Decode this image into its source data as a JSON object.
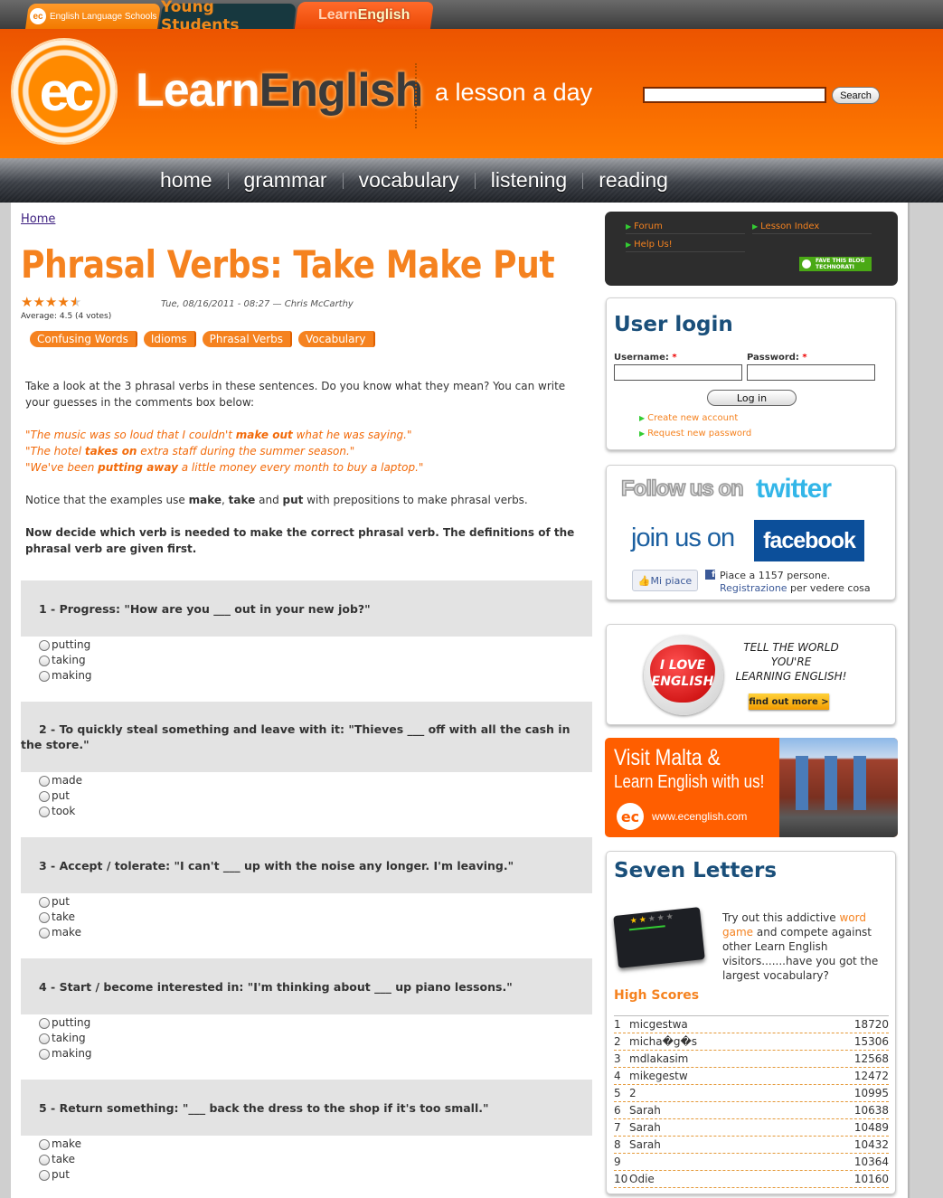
{
  "site_tabs": {
    "ec_schools": "English Language Schools",
    "ec_badge": "ec",
    "young_students": "Young Students",
    "learn_english_part1": "Learn",
    "learn_english_part2": "English"
  },
  "header": {
    "logo_text": "ec",
    "brand_part1": "Learn",
    "brand_part2": "English",
    "tagline": "a lesson a day",
    "search_value": "",
    "search_button": "Search"
  },
  "nav": {
    "items": [
      "home",
      "grammar",
      "vocabulary",
      "listening",
      "reading"
    ]
  },
  "breadcrumb": "Home",
  "article": {
    "title": "Phrasal Verbs: Take Make Put",
    "rating": {
      "stars": 4.5,
      "max": 5,
      "text": "Average: 4.5 (4 votes)"
    },
    "meta": "Tue, 08/16/2011 - 08:27 — Chris McCarthy",
    "tags": [
      "Confusing Words",
      "Idioms",
      "Phrasal Verbs",
      "Vocabulary"
    ],
    "intro": "Take a look at the 3 phrasal verbs in these sentences. Do you know what they mean? You can write your guesses in the comments box below:",
    "examples": [
      {
        "before": "\"The music was so loud that I couldn't ",
        "bold": "make out",
        "after": " what he was saying.\""
      },
      {
        "before": "\"The hotel ",
        "bold": "takes on",
        "after": " extra staff during the summer season.\""
      },
      {
        "before": "\"We've been ",
        "bold": "putting away",
        "after": " a little money every month to buy a laptop.\""
      }
    ],
    "notice": {
      "p1": "Notice that the examples use ",
      "w1": "make",
      "p2": ", ",
      "w2": "take",
      "p3": " and ",
      "w3": "put",
      "p4": " with prepositions to make phrasal verbs."
    },
    "instructions": "Now decide which verb is needed to make the correct phrasal verb. The definitions of the phrasal verb are given first."
  },
  "questions": [
    {
      "text": "1 - Progress: \"How are you ___ out in your new job?\"",
      "options": [
        "putting",
        "taking",
        "making"
      ]
    },
    {
      "text": "2 - To quickly steal something and leave with it: \"Thieves ___ off with all the cash in the store.\"",
      "options": [
        "made",
        "put",
        "took"
      ]
    },
    {
      "text": "3 - Accept / tolerate: \"I can't ___ up with the noise any longer. I'm leaving.\"",
      "options": [
        "put",
        "take",
        "make"
      ]
    },
    {
      "text": "4 - Start / become interested in: \"I'm thinking about ___ up piano lessons.\"",
      "options": [
        "putting",
        "taking",
        "making"
      ]
    },
    {
      "text": "5 - Return something: \"___ back the dress to the shop if it's too small.\"",
      "options": [
        "make",
        "take",
        "put"
      ]
    }
  ],
  "sidebar": {
    "links": {
      "forum": "Forum",
      "lesson_index": "Lesson Index",
      "help_us": "Help Us!"
    },
    "technorati_line1": "FAVE THIS BLOG",
    "technorati_line2": "TECHNORATI",
    "login": {
      "title": "User login",
      "username_label": "Username:",
      "password_label": "Password:",
      "required_mark": "*",
      "username_value": "",
      "password_value": "",
      "login_button": "Log in",
      "create_account": "Create new account",
      "request_password": "Request new password"
    },
    "social": {
      "follow_text": "Follow us on",
      "twitter_text": "twitter",
      "join_text": "join us on",
      "facebook_text": "facebook",
      "like_button": "Mi piace",
      "fb_icon": "f",
      "likes_text": "Piace a 1157 persone.",
      "register_link": "Registrazione",
      "register_rest": " per vedere cosa piace ai tuoi amici."
    },
    "love": {
      "badge_line1": "I LOVE",
      "badge_line2": "ENGLISH",
      "tell_line1": "TELL THE WORLD",
      "tell_line2": "YOU'RE",
      "tell_line3": "LEARNING ENGLISH!",
      "find_out": "find out more >"
    },
    "malta": {
      "line1": "Visit Malta &",
      "line2": "Learn English with us!",
      "logo": "ec",
      "url": "www.ecenglish.com"
    },
    "seven_letters": {
      "title": "Seven Letters",
      "desc_before": "Try out this addictive ",
      "desc_link": "word game",
      "desc_after": " and compete against other Learn English visitors.......have you got the largest vocabulary?",
      "high_scores_title": "High Scores",
      "scores": [
        {
          "rank": "1",
          "name": "micgestwa",
          "score": "18720"
        },
        {
          "rank": "2",
          "name": "micha�g�s",
          "score": "15306"
        },
        {
          "rank": "3",
          "name": "mdlakasim",
          "score": "12568"
        },
        {
          "rank": "4",
          "name": "mikegestw",
          "score": "12472"
        },
        {
          "rank": "5",
          "name": "2",
          "score": "10995"
        },
        {
          "rank": "6",
          "name": "Sarah",
          "score": "10638"
        },
        {
          "rank": "7",
          "name": "Sarah",
          "score": "10489"
        },
        {
          "rank": "8",
          "name": "Sarah",
          "score": "10432"
        },
        {
          "rank": "9",
          "name": "",
          "score": "10364"
        },
        {
          "rank": "10",
          "name": "Odie",
          "score": "10160"
        }
      ]
    }
  },
  "colors": {
    "brand_orange": "#f5821f",
    "header_orange": "#ff7b00",
    "heading_blue": "#1a4f7a",
    "question_bg": "#e3e3e3",
    "nav_dark": "#1e2126"
  }
}
